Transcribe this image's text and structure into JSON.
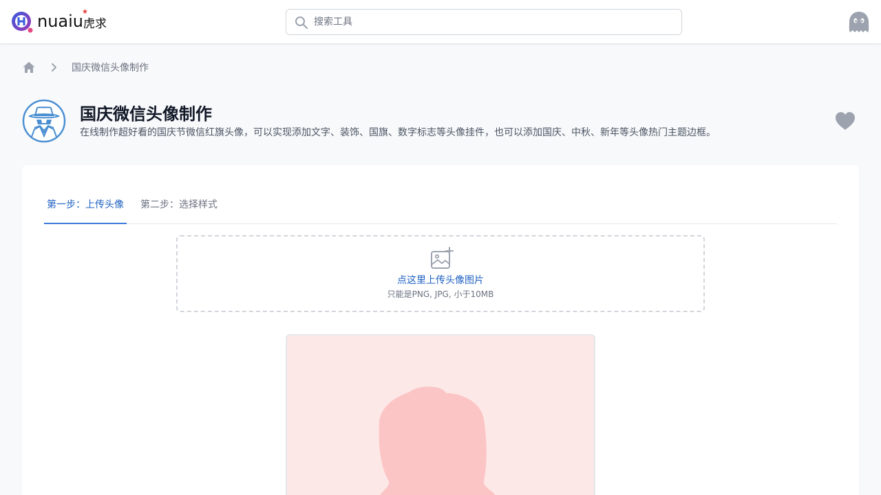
{
  "header": {
    "logo_text": "nuaiu",
    "logo_cn": "虎求",
    "search_placeholder": "搜索工具"
  },
  "breadcrumb": {
    "current": "国庆微信头像制作"
  },
  "tool": {
    "title": "国庆微信头像制作",
    "description": "在线制作超好看的国庆节微信红旗头像，可以实现添加文字、装饰、国旗、数字标志等头像挂件，也可以添加国庆、中秋、新年等头像热门主题边框。"
  },
  "tabs": [
    {
      "label": "第一步：上传头像",
      "active": true
    },
    {
      "label": "第二步：选择样式",
      "active": false
    }
  ],
  "upload": {
    "label": "点这里上传头像图片",
    "hint": "只能是PNG, JPG, 小于10MB"
  },
  "colors": {
    "accent": "#1d5fc2",
    "preview_bg": "#fde8e8",
    "silhouette": "#fcc5c5"
  },
  "icons": {
    "home": "home-icon",
    "chevron": "chevron-right-icon",
    "search": "search-icon",
    "favorite": "heart-icon",
    "upload": "image-add-icon",
    "avatar": "ghost-avatar-icon",
    "tool": "spy-icon"
  }
}
